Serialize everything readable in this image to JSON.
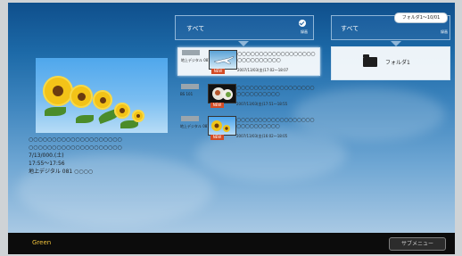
{
  "preview": {
    "title_line1": "○○○○○○○○○○○○○○○○○○○○",
    "title_line2": "○○○○○○○○○○○○○○○○○○○○",
    "date": "7/13/000.(土)",
    "time": "17:55～17:56",
    "channel": "地上デジタル 081 ○○○○"
  },
  "list_header": {
    "title": "すべて",
    "label": "録画"
  },
  "side_header": {
    "title": "すべて",
    "label": "録画",
    "badge": "フォルダ1～10/01"
  },
  "items": [
    {
      "source": "地上デジタル 081",
      "new": "NEW",
      "title": "○○○○○○○○○○○○○○○○○○○○○○○○○○○○",
      "date": "2007/13/03(金)17:02～18:07"
    },
    {
      "source": "BS 101",
      "new": "NEW",
      "title": "○○○○○○○○○○○○○○○○○○○○○○○○○○○○",
      "date": "2007/13/03(金)17:51～18:55"
    },
    {
      "source": "地上デジタル 081",
      "new": "NEW",
      "title": "○○○○○○○○○○○○○○○○○○○○○○○○○○○○",
      "date": "2007/13/03(金)16:02～18:05"
    }
  ],
  "folder": {
    "name": "フォルダ1"
  },
  "bottom": {
    "left_icon_text": "Green",
    "submenu": "サブメニュー"
  },
  "colors": {
    "new_tag": "#d44b24",
    "header_blue": "#1b5e9e"
  }
}
